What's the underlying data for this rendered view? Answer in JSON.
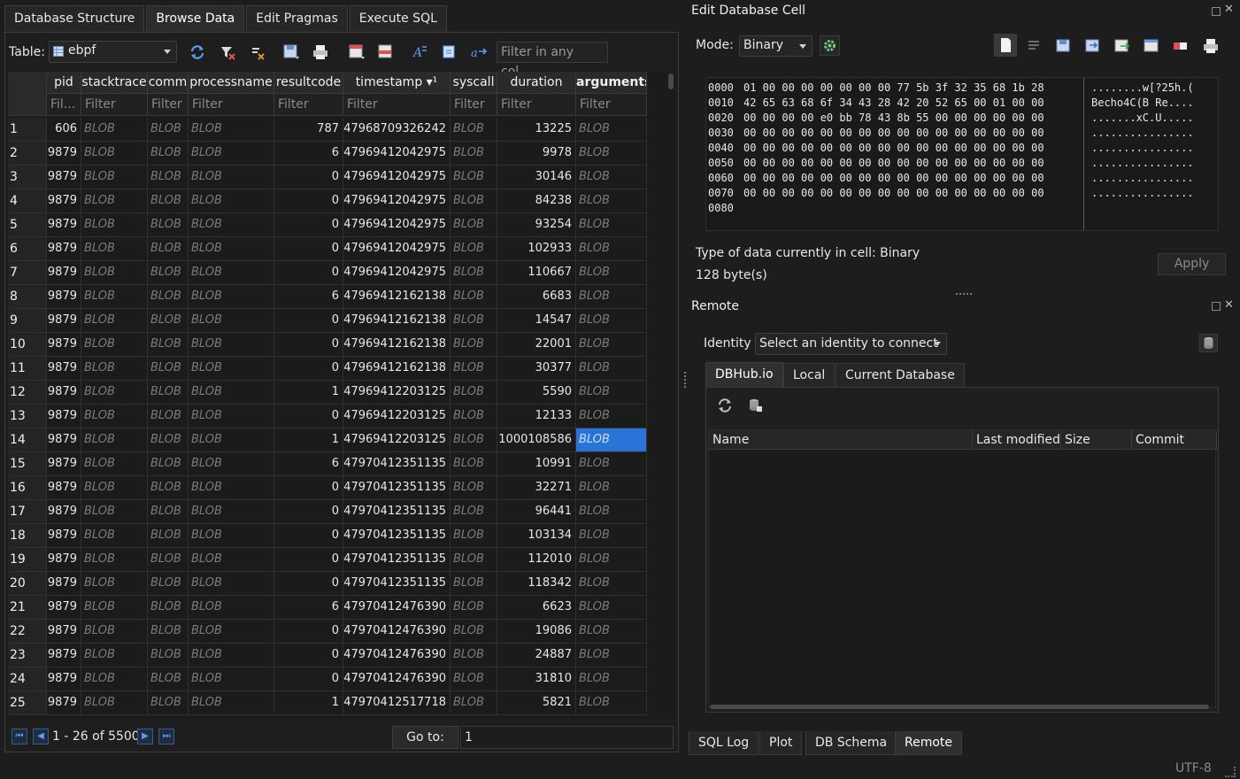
{
  "main_tabs": [
    "Database Structure",
    "Browse Data",
    "Edit Pragmas",
    "Execute SQL"
  ],
  "browse": {
    "table_label": "Table:",
    "table_value": "ebpf",
    "filter_any_placeholder": "Filter in any col...",
    "columns": [
      "pid",
      "stacktrace",
      "comm",
      "processname",
      "resultcode",
      "timestamp ▾¹",
      "syscall",
      "duration",
      "arguments"
    ],
    "filters": [
      "Fil...",
      "Filter",
      "Filter",
      "Filter",
      "Filter",
      "Filter",
      "Filter",
      "Filter",
      "Filter"
    ],
    "rows": [
      {
        "n": "1",
        "pid": "606",
        "stacktrace": "BLOB",
        "comm": "BLOB",
        "processname": "BLOB",
        "resultcode": "787",
        "timestamp": "47968709326242",
        "syscall": "BLOB",
        "duration": "13225",
        "arguments": "BLOB"
      },
      {
        "n": "2",
        "pid": "9879",
        "stacktrace": "BLOB",
        "comm": "BLOB",
        "processname": "BLOB",
        "resultcode": "6",
        "timestamp": "47969412042975",
        "syscall": "BLOB",
        "duration": "9978",
        "arguments": "BLOB"
      },
      {
        "n": "3",
        "pid": "9879",
        "stacktrace": "BLOB",
        "comm": "BLOB",
        "processname": "BLOB",
        "resultcode": "0",
        "timestamp": "47969412042975",
        "syscall": "BLOB",
        "duration": "30146",
        "arguments": "BLOB"
      },
      {
        "n": "4",
        "pid": "9879",
        "stacktrace": "BLOB",
        "comm": "BLOB",
        "processname": "BLOB",
        "resultcode": "0",
        "timestamp": "47969412042975",
        "syscall": "BLOB",
        "duration": "84238",
        "arguments": "BLOB"
      },
      {
        "n": "5",
        "pid": "9879",
        "stacktrace": "BLOB",
        "comm": "BLOB",
        "processname": "BLOB",
        "resultcode": "0",
        "timestamp": "47969412042975",
        "syscall": "BLOB",
        "duration": "93254",
        "arguments": "BLOB"
      },
      {
        "n": "6",
        "pid": "9879",
        "stacktrace": "BLOB",
        "comm": "BLOB",
        "processname": "BLOB",
        "resultcode": "0",
        "timestamp": "47969412042975",
        "syscall": "BLOB",
        "duration": "102933",
        "arguments": "BLOB"
      },
      {
        "n": "7",
        "pid": "9879",
        "stacktrace": "BLOB",
        "comm": "BLOB",
        "processname": "BLOB",
        "resultcode": "0",
        "timestamp": "47969412042975",
        "syscall": "BLOB",
        "duration": "110667",
        "arguments": "BLOB"
      },
      {
        "n": "8",
        "pid": "9879",
        "stacktrace": "BLOB",
        "comm": "BLOB",
        "processname": "BLOB",
        "resultcode": "6",
        "timestamp": "47969412162138",
        "syscall": "BLOB",
        "duration": "6683",
        "arguments": "BLOB"
      },
      {
        "n": "9",
        "pid": "9879",
        "stacktrace": "BLOB",
        "comm": "BLOB",
        "processname": "BLOB",
        "resultcode": "0",
        "timestamp": "47969412162138",
        "syscall": "BLOB",
        "duration": "14547",
        "arguments": "BLOB"
      },
      {
        "n": "10",
        "pid": "9879",
        "stacktrace": "BLOB",
        "comm": "BLOB",
        "processname": "BLOB",
        "resultcode": "0",
        "timestamp": "47969412162138",
        "syscall": "BLOB",
        "duration": "22001",
        "arguments": "BLOB"
      },
      {
        "n": "11",
        "pid": "9879",
        "stacktrace": "BLOB",
        "comm": "BLOB",
        "processname": "BLOB",
        "resultcode": "0",
        "timestamp": "47969412162138",
        "syscall": "BLOB",
        "duration": "30377",
        "arguments": "BLOB"
      },
      {
        "n": "12",
        "pid": "9879",
        "stacktrace": "BLOB",
        "comm": "BLOB",
        "processname": "BLOB",
        "resultcode": "1",
        "timestamp": "47969412203125",
        "syscall": "BLOB",
        "duration": "5590",
        "arguments": "BLOB"
      },
      {
        "n": "13",
        "pid": "9879",
        "stacktrace": "BLOB",
        "comm": "BLOB",
        "processname": "BLOB",
        "resultcode": "0",
        "timestamp": "47969412203125",
        "syscall": "BLOB",
        "duration": "12133",
        "arguments": "BLOB"
      },
      {
        "n": "14",
        "pid": "9879",
        "stacktrace": "BLOB",
        "comm": "BLOB",
        "processname": "BLOB",
        "resultcode": "1",
        "timestamp": "47969412203125",
        "syscall": "BLOB",
        "duration": "1000108586",
        "arguments": "BLOB",
        "selected": true
      },
      {
        "n": "15",
        "pid": "9879",
        "stacktrace": "BLOB",
        "comm": "BLOB",
        "processname": "BLOB",
        "resultcode": "6",
        "timestamp": "47970412351135",
        "syscall": "BLOB",
        "duration": "10991",
        "arguments": "BLOB"
      },
      {
        "n": "16",
        "pid": "9879",
        "stacktrace": "BLOB",
        "comm": "BLOB",
        "processname": "BLOB",
        "resultcode": "0",
        "timestamp": "47970412351135",
        "syscall": "BLOB",
        "duration": "32271",
        "arguments": "BLOB"
      },
      {
        "n": "17",
        "pid": "9879",
        "stacktrace": "BLOB",
        "comm": "BLOB",
        "processname": "BLOB",
        "resultcode": "0",
        "timestamp": "47970412351135",
        "syscall": "BLOB",
        "duration": "96441",
        "arguments": "BLOB"
      },
      {
        "n": "18",
        "pid": "9879",
        "stacktrace": "BLOB",
        "comm": "BLOB",
        "processname": "BLOB",
        "resultcode": "0",
        "timestamp": "47970412351135",
        "syscall": "BLOB",
        "duration": "103134",
        "arguments": "BLOB"
      },
      {
        "n": "19",
        "pid": "9879",
        "stacktrace": "BLOB",
        "comm": "BLOB",
        "processname": "BLOB",
        "resultcode": "0",
        "timestamp": "47970412351135",
        "syscall": "BLOB",
        "duration": "112010",
        "arguments": "BLOB"
      },
      {
        "n": "20",
        "pid": "9879",
        "stacktrace": "BLOB",
        "comm": "BLOB",
        "processname": "BLOB",
        "resultcode": "0",
        "timestamp": "47970412351135",
        "syscall": "BLOB",
        "duration": "118342",
        "arguments": "BLOB"
      },
      {
        "n": "21",
        "pid": "9879",
        "stacktrace": "BLOB",
        "comm": "BLOB",
        "processname": "BLOB",
        "resultcode": "6",
        "timestamp": "47970412476390",
        "syscall": "BLOB",
        "duration": "6623",
        "arguments": "BLOB"
      },
      {
        "n": "22",
        "pid": "9879",
        "stacktrace": "BLOB",
        "comm": "BLOB",
        "processname": "BLOB",
        "resultcode": "0",
        "timestamp": "47970412476390",
        "syscall": "BLOB",
        "duration": "19086",
        "arguments": "BLOB"
      },
      {
        "n": "23",
        "pid": "9879",
        "stacktrace": "BLOB",
        "comm": "BLOB",
        "processname": "BLOB",
        "resultcode": "0",
        "timestamp": "47970412476390",
        "syscall": "BLOB",
        "duration": "24887",
        "arguments": "BLOB"
      },
      {
        "n": "24",
        "pid": "9879",
        "stacktrace": "BLOB",
        "comm": "BLOB",
        "processname": "BLOB",
        "resultcode": "0",
        "timestamp": "47970412476390",
        "syscall": "BLOB",
        "duration": "31810",
        "arguments": "BLOB"
      },
      {
        "n": "25",
        "pid": "9879",
        "stacktrace": "BLOB",
        "comm": "BLOB",
        "processname": "BLOB",
        "resultcode": "1",
        "timestamp": "47970412517718",
        "syscall": "BLOB",
        "duration": "5821",
        "arguments": "BLOB"
      }
    ],
    "record_range": "1 - 26 of 5500",
    "goto_label": "Go to:",
    "goto_value": "1"
  },
  "edit_cell": {
    "title": "Edit Database Cell",
    "mode_label": "Mode:",
    "mode_value": "Binary",
    "hex_lines": [
      {
        "addr": "0000",
        "bytes": "01 00 00 00 00 00 00 00 77 5b 3f 32 35 68 1b 28",
        "ascii": "........w[?25h.("
      },
      {
        "addr": "0010",
        "bytes": "42 65 63 68 6f 34 43 28 42 20 52 65 00 01 00 00",
        "ascii": "Becho4C(B Re...."
      },
      {
        "addr": "0020",
        "bytes": "00 00 00 00 e0 bb 78 43 8b 55 00 00 00 00 00 00",
        "ascii": ".......xC.U....."
      },
      {
        "addr": "0030",
        "bytes": "00 00 00 00 00 00 00 00 00 00 00 00 00 00 00 00",
        "ascii": "................"
      },
      {
        "addr": "0040",
        "bytes": "00 00 00 00 00 00 00 00 00 00 00 00 00 00 00 00",
        "ascii": "................"
      },
      {
        "addr": "0050",
        "bytes": "00 00 00 00 00 00 00 00 00 00 00 00 00 00 00 00",
        "ascii": "................"
      },
      {
        "addr": "0060",
        "bytes": "00 00 00 00 00 00 00 00 00 00 00 00 00 00 00 00",
        "ascii": "................"
      },
      {
        "addr": "0070",
        "bytes": "00 00 00 00 00 00 00 00 00 00 00 00 00 00 00 00",
        "ascii": "................"
      },
      {
        "addr": "0080",
        "bytes": "",
        "ascii": ""
      }
    ],
    "type_text": "Type of data currently in cell: Binary",
    "size_text": "128 byte(s)",
    "apply_label": "Apply"
  },
  "remote": {
    "title": "Remote",
    "identity_label": "Identity",
    "identity_value": "Select an identity to connect",
    "tabs": [
      "DBHub.io",
      "Local",
      "Current Database"
    ],
    "columns": [
      "Name",
      "Last modified",
      "Size",
      "Commit"
    ]
  },
  "bottom_tabs": [
    "SQL Log",
    "Plot",
    "DB Schema",
    "Remote"
  ],
  "status": {
    "encoding": "UTF-8"
  },
  "colors": {
    "selection": "#2a74d8",
    "background": "#1d1d1d",
    "nav_icon": "#5b9df3"
  }
}
